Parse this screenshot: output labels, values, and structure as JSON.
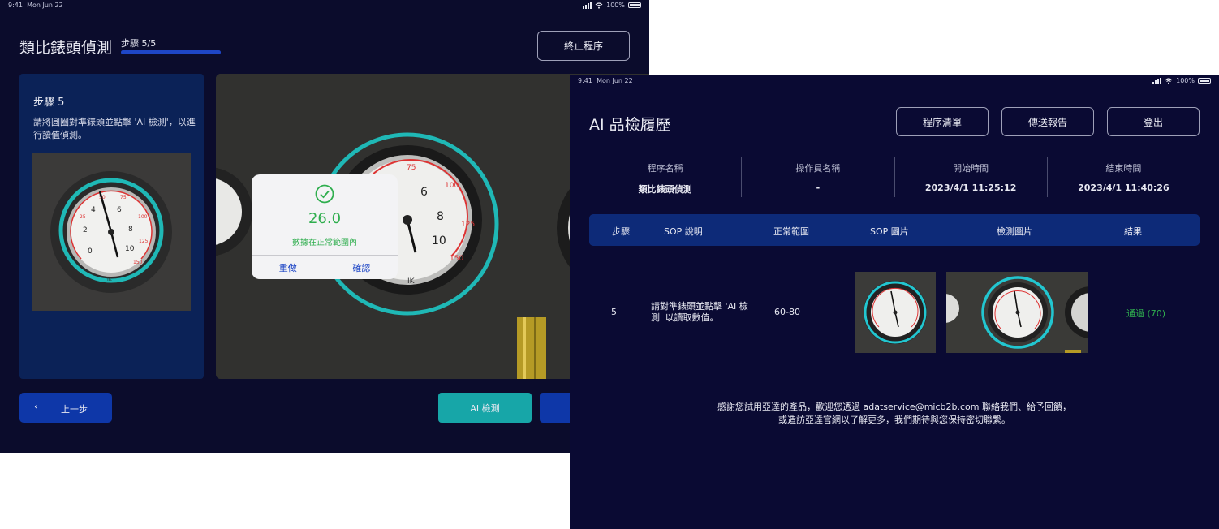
{
  "screen1": {
    "status": {
      "time": "9:41",
      "date": "Mon Jun 22",
      "battery": "100%"
    },
    "title": "類比錶頭偵測",
    "step_indicator": "步驟 5/5",
    "progress_fraction": 1.0,
    "stop_button": "終止程序",
    "step_card": {
      "heading": "步驟 5",
      "description": "請將圓圈對準錶頭並點擊 'AI 檢測'，以進行讀值偵測。"
    },
    "dialog": {
      "value": "26.0",
      "message": "數據在正常範圍內",
      "retry": "重做",
      "confirm": "確認"
    },
    "prev_button": "上一步",
    "ai_button": "AI 檢測"
  },
  "screen2": {
    "status": {
      "time": "9:41",
      "date": "Mon Jun 22",
      "battery": "100%"
    },
    "title": "AI 品檢履歷",
    "buttons": {
      "list": "程序清單",
      "send": "傳送報告",
      "logout": "登出"
    },
    "meta": [
      {
        "label": "程序名稱",
        "value": "類比錶頭偵測"
      },
      {
        "label": "操作員名稱",
        "value": "-"
      },
      {
        "label": "開始時間",
        "value": "2023/4/1 11:25:12"
      },
      {
        "label": "結束時間",
        "value": "2023/4/1 11:40:26"
      }
    ],
    "table": {
      "headers": [
        "步驟",
        "SOP 說明",
        "正常範圍",
        "SOP 圖片",
        "檢測圖片",
        "結果"
      ],
      "rows": [
        {
          "step": "5",
          "desc": "請對準錶頭並點擊 'AI 檢測' 以讀取數值。",
          "range": "60-80",
          "result": "通過 (70)"
        }
      ]
    },
    "footer": {
      "line1_pre": "感謝您試用亞達的產品，歡迎您透過 ",
      "email": "adatservice@micb2b.com",
      "line1_post": " 聯絡我們、給予回饋，",
      "line2_pre": "或造訪",
      "site_link": "亞達官網",
      "line2_post": "以了解更多，我們期待與您保持密切聯繫。"
    }
  },
  "colors": {
    "background": "#0b0c2c",
    "accent_blue": "#0e37a8",
    "teal": "#17a6a8",
    "pass_green": "#2fae4e"
  }
}
